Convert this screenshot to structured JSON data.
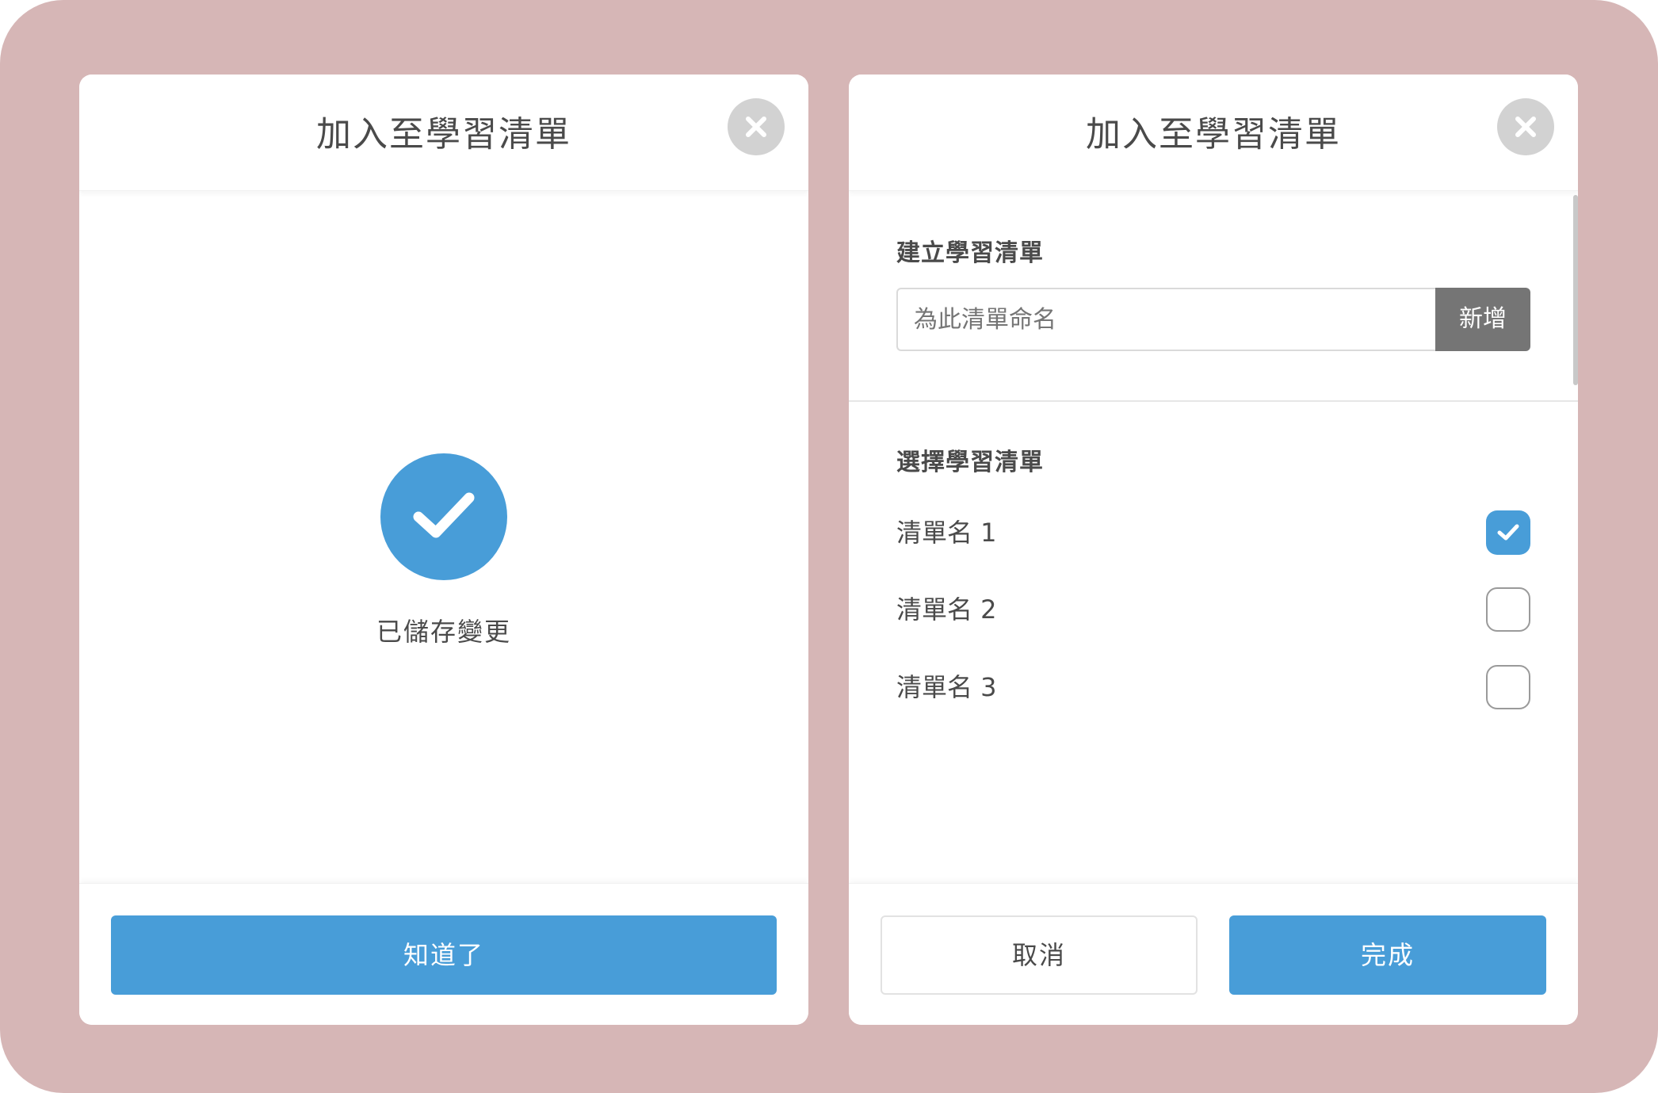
{
  "colors": {
    "background": "#d6b6b6",
    "accent": "#489dd8",
    "add_button": "#757575",
    "close_button": "#d2d2d2"
  },
  "success_modal": {
    "title": "加入至學習清單",
    "close_icon": "close-icon",
    "status_icon": "check-circle-icon",
    "message": "已儲存變更",
    "confirm_label": "知道了"
  },
  "list_modal": {
    "title": "加入至學習清單",
    "close_icon": "close-icon",
    "create_section": {
      "label": "建立學習清單",
      "input_value": "",
      "input_placeholder": "為此清單命名",
      "add_label": "新增"
    },
    "choose_section": {
      "label": "選擇學習清單",
      "items": [
        {
          "name": "清單名 1",
          "checked": true
        },
        {
          "name": "清單名 2",
          "checked": false
        },
        {
          "name": "清單名 3",
          "checked": false
        }
      ]
    },
    "cancel_label": "取消",
    "done_label": "完成"
  }
}
